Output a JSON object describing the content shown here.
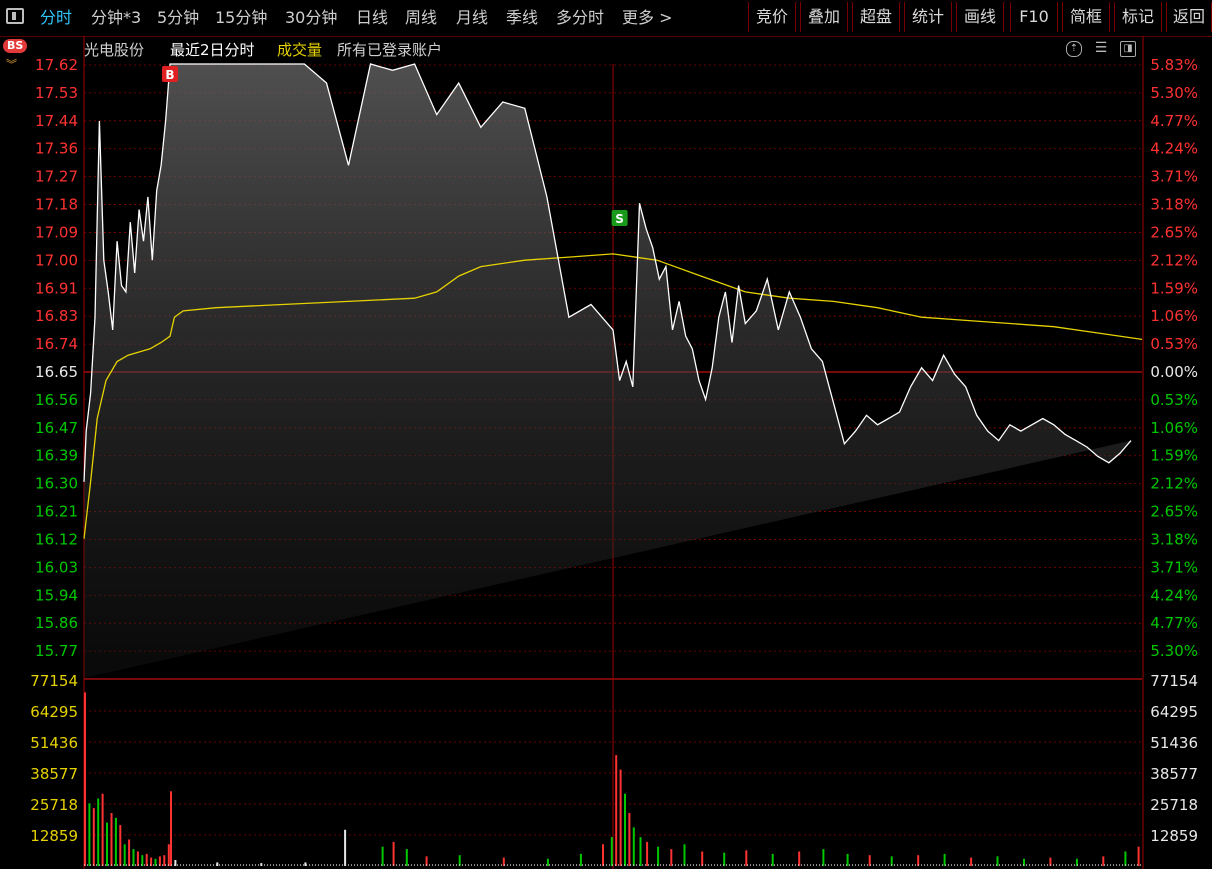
{
  "toolbar": {
    "tabs": [
      "分时",
      "分钟*3",
      "5分钟",
      "15分钟",
      "30分钟",
      "日线",
      "周线",
      "月线",
      "季线",
      "多分时",
      "更多 >"
    ],
    "right_buttons": [
      "竞价",
      "叠加",
      "超盘",
      "统计",
      "画线",
      "F10",
      "简框",
      "标记",
      "返回"
    ]
  },
  "info": {
    "badge": "BS",
    "stock_name": "光电股份",
    "period_label": "最近2日分时",
    "volume_label": "成交量",
    "account_label": "所有已登录账户"
  },
  "colors": {
    "price_line": "#ffffff",
    "avg_line": "#e6d200",
    "up": "#ff3232",
    "down": "#00c800",
    "grid": "#8a0000",
    "volume_axis": "#e6d200"
  },
  "chart_data": [
    {
      "type": "line",
      "title": "光电股份 最近2日分时",
      "days": 2,
      "base_price": 16.65,
      "ylim": [
        15.68,
        17.62
      ],
      "y_ticks_left": [
        "17.62",
        "17.53",
        "17.44",
        "17.36",
        "17.27",
        "17.18",
        "17.09",
        "17.00",
        "16.91",
        "16.83",
        "16.74",
        "16.65",
        "16.56",
        "16.47",
        "16.39",
        "16.30",
        "16.21",
        "16.12",
        "16.03",
        "15.94",
        "15.86",
        "15.77"
      ],
      "y_ticks_right": [
        "5.83%",
        "5.30%",
        "4.77%",
        "4.24%",
        "3.71%",
        "3.18%",
        "2.65%",
        "2.12%",
        "1.59%",
        "1.06%",
        "0.53%",
        "0.00%",
        "0.53%",
        "1.06%",
        "1.59%",
        "2.12%",
        "2.65%",
        "3.18%",
        "3.71%",
        "4.24%",
        "4.77%",
        "5.30%"
      ],
      "markers": [
        {
          "label": "B",
          "day": 1,
          "minute": 39,
          "color": "#e02020"
        },
        {
          "label": "S",
          "day": 2,
          "minute": 3,
          "color": "#1a9a1a"
        }
      ],
      "series": [
        {
          "name": "价格",
          "points_minute": [
            0,
            1,
            3,
            5,
            7,
            9,
            11,
            13,
            15,
            17,
            19,
            21,
            23,
            25,
            27,
            29,
            31,
            33,
            35,
            37,
            39,
            42,
            45,
            50,
            55,
            60,
            70,
            80,
            90,
            100,
            110,
            120,
            130,
            140,
            150,
            160,
            170,
            180,
            190,
            200,
            210,
            220,
            230,
            240,
            243,
            246,
            249,
            252,
            255,
            258,
            261,
            264,
            267,
            270,
            273,
            276,
            279,
            282,
            285,
            288,
            291,
            294,
            297,
            300,
            305,
            310,
            315,
            320,
            325,
            330,
            335,
            340,
            345,
            350,
            355,
            360,
            365,
            370,
            375,
            380,
            385,
            390,
            395,
            400,
            405,
            410,
            415,
            420,
            425,
            430,
            435,
            440,
            445,
            450,
            455,
            460,
            465,
            470,
            475,
            480
          ],
          "values": [
            16.3,
            16.46,
            16.58,
            16.82,
            17.44,
            17.0,
            16.9,
            16.78,
            17.06,
            16.92,
            16.9,
            17.12,
            16.96,
            17.16,
            17.06,
            17.2,
            17.0,
            17.22,
            17.3,
            17.44,
            17.62,
            17.62,
            17.62,
            17.62,
            17.62,
            17.62,
            17.62,
            17.62,
            17.62,
            17.62,
            17.56,
            17.3,
            17.62,
            17.6,
            17.62,
            17.46,
            17.56,
            17.42,
            17.5,
            17.48,
            17.2,
            16.82,
            16.86,
            16.78,
            16.62,
            16.68,
            16.6,
            17.18,
            17.1,
            17.04,
            16.94,
            16.98,
            16.78,
            16.87,
            16.76,
            16.72,
            16.62,
            16.56,
            16.66,
            16.82,
            16.9,
            16.74,
            16.92,
            16.8,
            16.84,
            16.94,
            16.78,
            16.9,
            16.82,
            16.72,
            16.68,
            16.55,
            16.42,
            16.46,
            16.51,
            16.48,
            16.5,
            16.52,
            16.6,
            16.66,
            16.62,
            16.7,
            16.64,
            16.6,
            16.51,
            16.46,
            16.43,
            16.48,
            16.46,
            16.48,
            16.5,
            16.48,
            16.45,
            16.43,
            16.41,
            16.38,
            16.36,
            16.39,
            16.43
          ]
        },
        {
          "name": "均价",
          "points_minute": [
            0,
            3,
            6,
            10,
            15,
            20,
            25,
            30,
            35,
            39,
            41,
            45,
            60,
            90,
            120,
            150,
            160,
            170,
            180,
            200,
            220,
            240,
            260,
            280,
            300,
            320,
            340,
            360,
            380,
            400,
            420,
            440,
            460,
            480
          ],
          "values": [
            16.12,
            16.3,
            16.5,
            16.62,
            16.68,
            16.7,
            16.71,
            16.72,
            16.74,
            16.76,
            16.82,
            16.84,
            16.85,
            16.86,
            16.87,
            16.88,
            16.9,
            16.95,
            16.98,
            17.0,
            17.01,
            17.02,
            17.0,
            16.95,
            16.9,
            16.88,
            16.87,
            16.85,
            16.82,
            16.81,
            16.8,
            16.79,
            16.77,
            16.75
          ]
        }
      ]
    },
    {
      "type": "bar",
      "title": "成交量",
      "ylim": [
        0,
        77154
      ],
      "y_ticks": [
        "77154",
        "64295",
        "51436",
        "38577",
        "25718",
        "12859"
      ],
      "bars": [
        {
          "minute": 0,
          "value": 72000,
          "dir": "up"
        },
        {
          "minute": 2,
          "value": 26000,
          "dir": "down"
        },
        {
          "minute": 4,
          "value": 24000,
          "dir": "up"
        },
        {
          "minute": 6,
          "value": 28000,
          "dir": "down"
        },
        {
          "minute": 8,
          "value": 30000,
          "dir": "up"
        },
        {
          "minute": 10,
          "value": 18000,
          "dir": "down"
        },
        {
          "minute": 12,
          "value": 22000,
          "dir": "up"
        },
        {
          "minute": 14,
          "value": 20000,
          "dir": "down"
        },
        {
          "minute": 16,
          "value": 17000,
          "dir": "up"
        },
        {
          "minute": 18,
          "value": 9000,
          "dir": "down"
        },
        {
          "minute": 20,
          "value": 11000,
          "dir": "up"
        },
        {
          "minute": 22,
          "value": 7000,
          "dir": "down"
        },
        {
          "minute": 24,
          "value": 6000,
          "dir": "up"
        },
        {
          "minute": 26,
          "value": 4500,
          "dir": "down"
        },
        {
          "minute": 28,
          "value": 5000,
          "dir": "up"
        },
        {
          "minute": 30,
          "value": 3500,
          "dir": "up"
        },
        {
          "minute": 32,
          "value": 3000,
          "dir": "down"
        },
        {
          "minute": 34,
          "value": 4000,
          "dir": "up"
        },
        {
          "minute": 36,
          "value": 4500,
          "dir": "up"
        },
        {
          "minute": 38,
          "value": 9000,
          "dir": "up"
        },
        {
          "minute": 39,
          "value": 31000,
          "dir": "up"
        },
        {
          "minute": 41,
          "value": 2500,
          "dir": "flat"
        },
        {
          "minute": 60,
          "value": 1500,
          "dir": "flat"
        },
        {
          "minute": 80,
          "value": 1200,
          "dir": "flat"
        },
        {
          "minute": 100,
          "value": 1500,
          "dir": "flat"
        },
        {
          "minute": 118,
          "value": 15000,
          "dir": "flat"
        },
        {
          "minute": 135,
          "value": 8000,
          "dir": "down"
        },
        {
          "minute": 140,
          "value": 10000,
          "dir": "up"
        },
        {
          "minute": 146,
          "value": 7000,
          "dir": "down"
        },
        {
          "minute": 155,
          "value": 4000,
          "dir": "up"
        },
        {
          "minute": 170,
          "value": 4500,
          "dir": "down"
        },
        {
          "minute": 190,
          "value": 3500,
          "dir": "up"
        },
        {
          "minute": 210,
          "value": 3000,
          "dir": "down"
        },
        {
          "minute": 225,
          "value": 5000,
          "dir": "down"
        },
        {
          "minute": 235,
          "value": 9000,
          "dir": "up"
        },
        {
          "minute": 239,
          "value": 12000,
          "dir": "down"
        },
        {
          "minute": 241,
          "value": 46000,
          "dir": "up"
        },
        {
          "minute": 243,
          "value": 40000,
          "dir": "up"
        },
        {
          "minute": 245,
          "value": 30000,
          "dir": "down"
        },
        {
          "minute": 247,
          "value": 22000,
          "dir": "up"
        },
        {
          "minute": 249,
          "value": 16000,
          "dir": "down"
        },
        {
          "minute": 252,
          "value": 12000,
          "dir": "down"
        },
        {
          "minute": 255,
          "value": 10000,
          "dir": "up"
        },
        {
          "minute": 260,
          "value": 8000,
          "dir": "down"
        },
        {
          "minute": 266,
          "value": 7000,
          "dir": "up"
        },
        {
          "minute": 272,
          "value": 9000,
          "dir": "down"
        },
        {
          "minute": 280,
          "value": 6000,
          "dir": "up"
        },
        {
          "minute": 290,
          "value": 5500,
          "dir": "down"
        },
        {
          "minute": 300,
          "value": 6500,
          "dir": "up"
        },
        {
          "minute": 312,
          "value": 5000,
          "dir": "down"
        },
        {
          "minute": 324,
          "value": 6000,
          "dir": "up"
        },
        {
          "minute": 335,
          "value": 7000,
          "dir": "down"
        },
        {
          "minute": 346,
          "value": 5000,
          "dir": "down"
        },
        {
          "minute": 356,
          "value": 4500,
          "dir": "up"
        },
        {
          "minute": 366,
          "value": 4000,
          "dir": "down"
        },
        {
          "minute": 378,
          "value": 4500,
          "dir": "up"
        },
        {
          "minute": 390,
          "value": 5000,
          "dir": "down"
        },
        {
          "minute": 402,
          "value": 3500,
          "dir": "up"
        },
        {
          "minute": 414,
          "value": 4000,
          "dir": "down"
        },
        {
          "minute": 426,
          "value": 3000,
          "dir": "down"
        },
        {
          "minute": 438,
          "value": 3500,
          "dir": "up"
        },
        {
          "minute": 450,
          "value": 3000,
          "dir": "down"
        },
        {
          "minute": 462,
          "value": 4000,
          "dir": "up"
        },
        {
          "minute": 472,
          "value": 6000,
          "dir": "down"
        },
        {
          "minute": 478,
          "value": 8000,
          "dir": "up"
        }
      ]
    }
  ]
}
